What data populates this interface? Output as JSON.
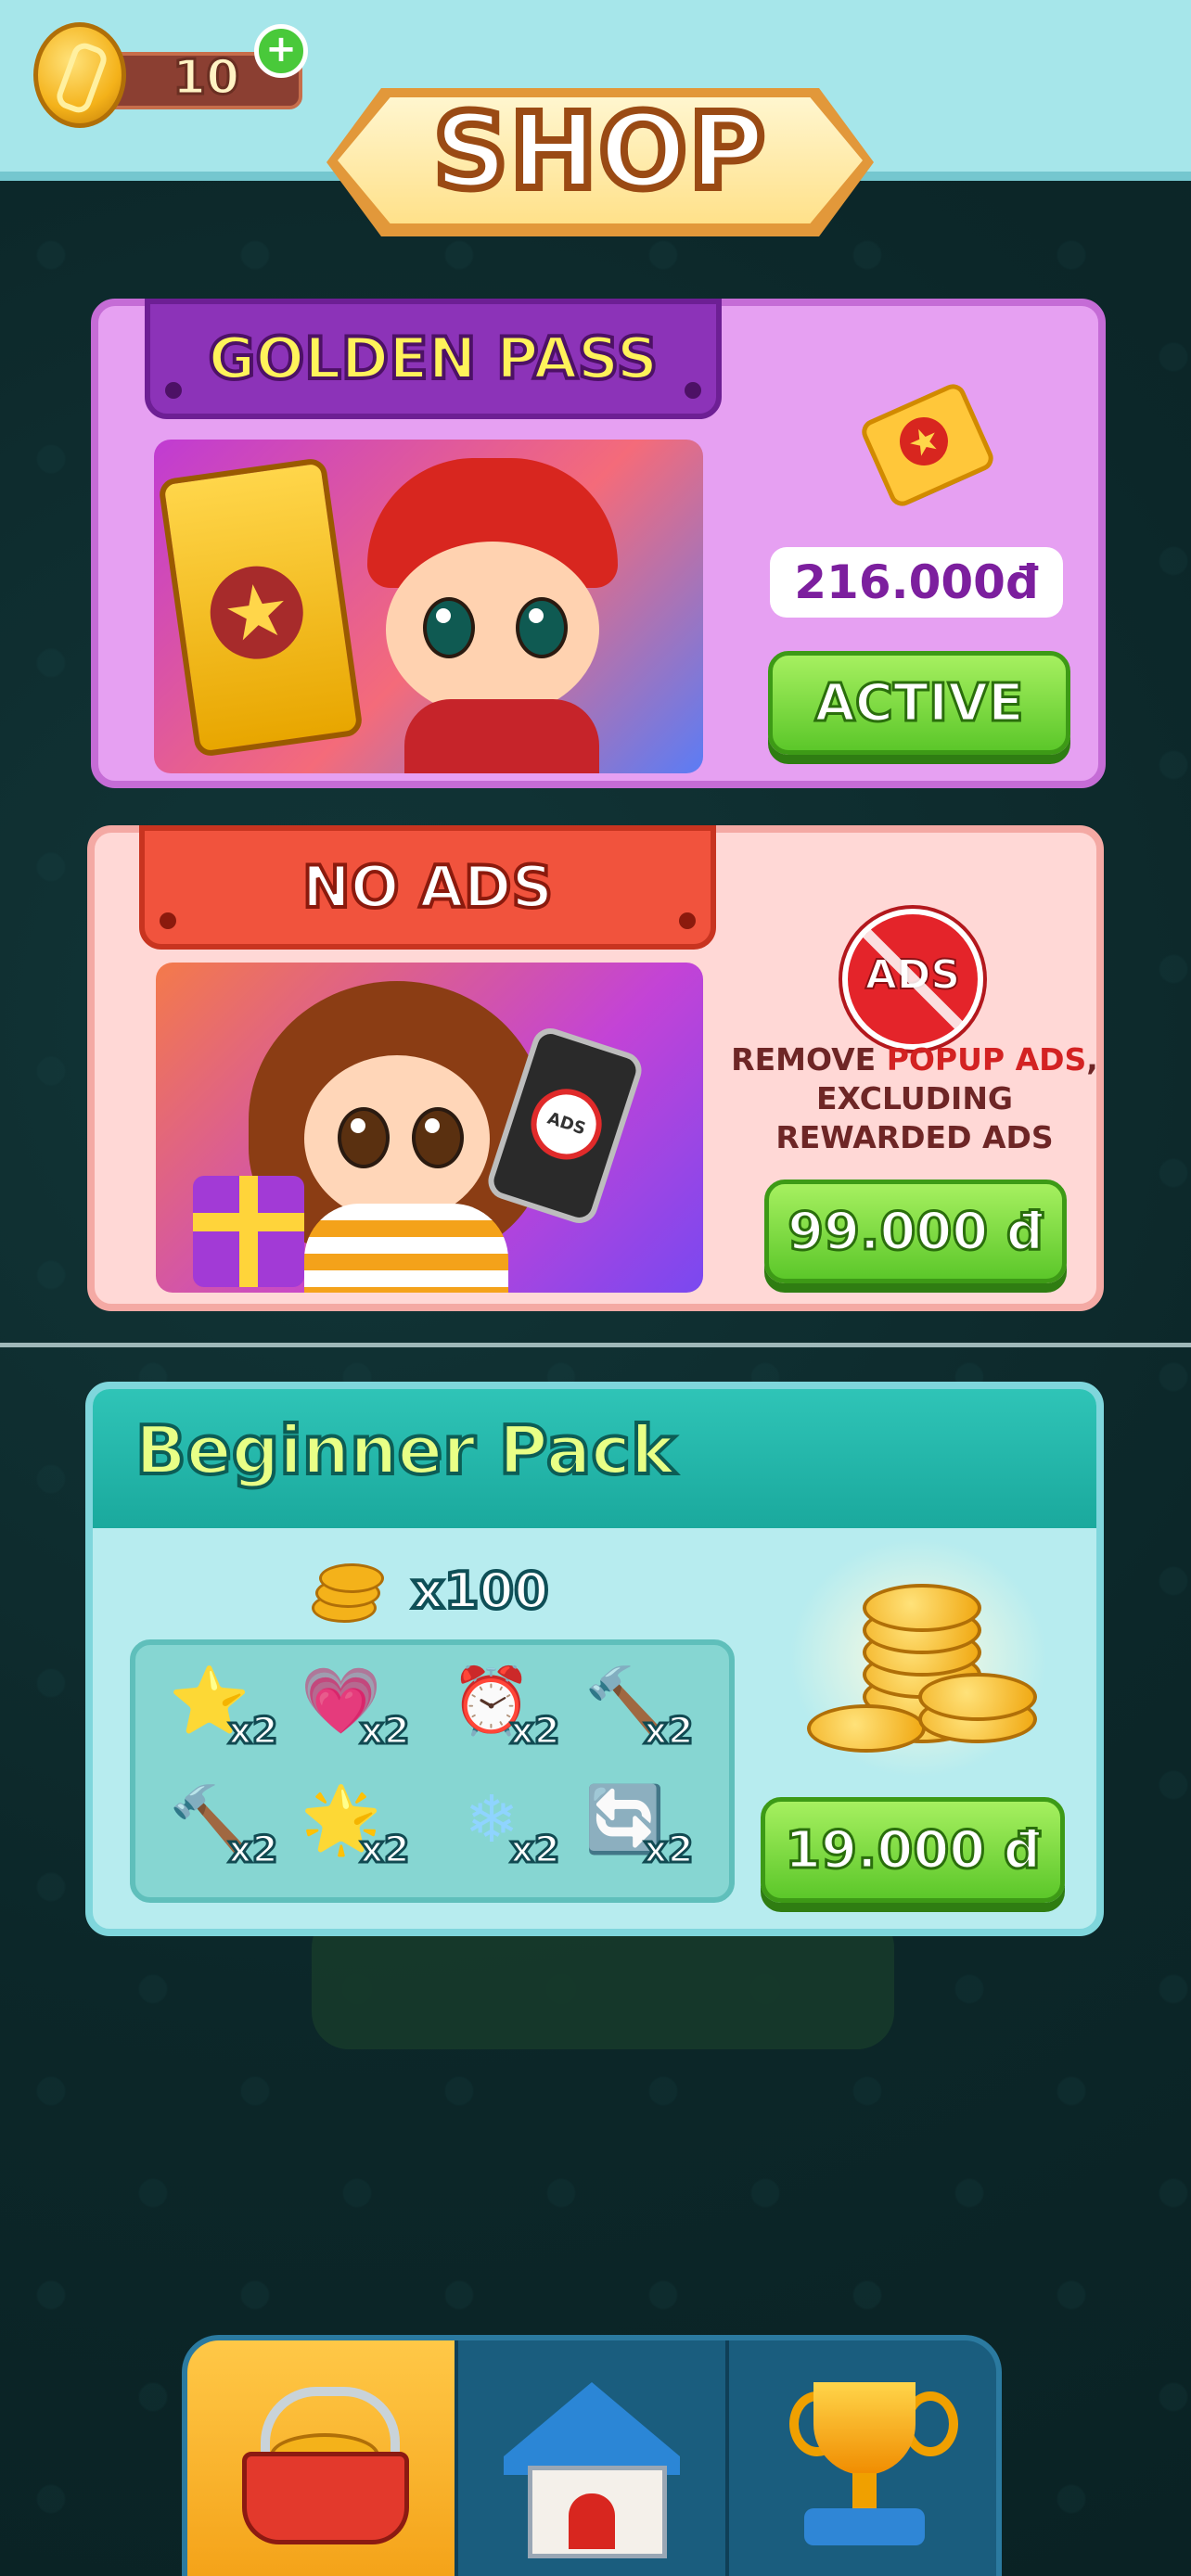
{
  "currency": {
    "coins": "10",
    "add_symbol": "+"
  },
  "header": {
    "title": "SHOP"
  },
  "golden_pass": {
    "title": "GOLDEN PASS",
    "price": "216.000đ",
    "button": "ACTIVE"
  },
  "no_ads": {
    "title": "NO ADS",
    "icon_label": "ADS",
    "phone_label": "ADS",
    "description_line1_a": "REMOVE ",
    "description_line1_b": "POPUP ADS",
    "description_line1_c": ",",
    "description_line2": "EXCLUDING",
    "description_line3": "REWARDED ADS",
    "price": "99.000 đ"
  },
  "beginner_pack": {
    "title": "Beginner Pack",
    "coins_qty": "x100",
    "items": [
      {
        "icon": "star-icon",
        "glyph": "⭐",
        "qty": "x2"
      },
      {
        "icon": "heart-icon",
        "glyph": "💗",
        "qty": "x2"
      },
      {
        "icon": "alarm-clock-icon",
        "glyph": "⏰",
        "qty": "x2"
      },
      {
        "icon": "hammer-icon",
        "glyph": "🔨",
        "qty": "x2"
      },
      {
        "icon": "mallet-icon",
        "glyph": "🔨",
        "qty": "x2"
      },
      {
        "icon": "magic-wand-icon",
        "glyph": "🌟",
        "qty": "x2"
      },
      {
        "icon": "snowflake-icon",
        "glyph": "❄",
        "qty": "x2"
      },
      {
        "icon": "shuffle-icon",
        "glyph": "🔄",
        "qty": "x2"
      }
    ],
    "price": "19.000 đ"
  },
  "bottom_nav": {
    "tabs": [
      {
        "name": "shop",
        "active": true
      },
      {
        "name": "home",
        "active": false
      },
      {
        "name": "leaderboard",
        "active": false
      }
    ]
  },
  "colors": {
    "accent_green": "#5cc72a",
    "golden_pass_purple": "#8c33b8",
    "no_ads_red": "#f1533d",
    "beginner_teal": "#1aa99d"
  }
}
